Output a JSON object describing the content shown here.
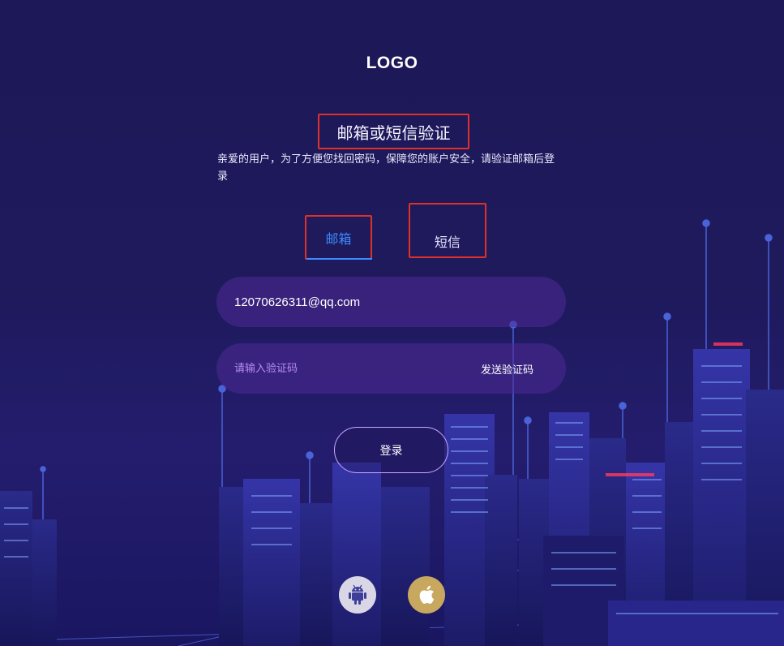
{
  "logo": "LOGO",
  "title": "邮箱或短信验证",
  "description": "亲爱的用户，为了方便您找回密码，保障您的账户安全，请验证邮箱后登录",
  "tabs": {
    "email": "邮箱",
    "sms": "短信",
    "active": "email"
  },
  "email_field": {
    "value": "12070626311@qq.com"
  },
  "code_field": {
    "placeholder": "请输入验证码",
    "send_label": "发送验证码"
  },
  "login_button": "登录",
  "app_downloads": [
    {
      "icon": "android-icon"
    },
    {
      "icon": "apple-icon"
    }
  ],
  "colors": {
    "accent_blue": "#3d8bff",
    "highlight_red": "#e0302a",
    "input_bg": "#4e2a96",
    "placeholder": "#b58cf2",
    "android_bg": "#d9d7e6",
    "apple_bg": "#c8a85e"
  }
}
